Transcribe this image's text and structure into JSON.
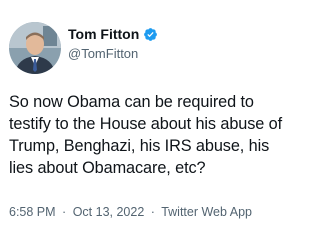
{
  "tweet": {
    "author": {
      "name": "Tom Fitton",
      "handle": "@TomFitton",
      "verified": true
    },
    "text": "So now Obama can be required to testify to the House about his abuse of Trump, Benghazi, his IRS abuse, his lies about Obamacare, etc?",
    "meta": {
      "time": "6:58 PM",
      "separator": "·",
      "date": "Oct 13, 2022",
      "source": "Twitter Web App"
    }
  },
  "colors": {
    "verified_badge": "#1d9bf0",
    "text_primary": "#0f1419",
    "text_secondary": "#536471",
    "background": "#ffffff"
  },
  "icons": {
    "avatar": "profile-photo",
    "verified": "verified-badge-icon"
  }
}
